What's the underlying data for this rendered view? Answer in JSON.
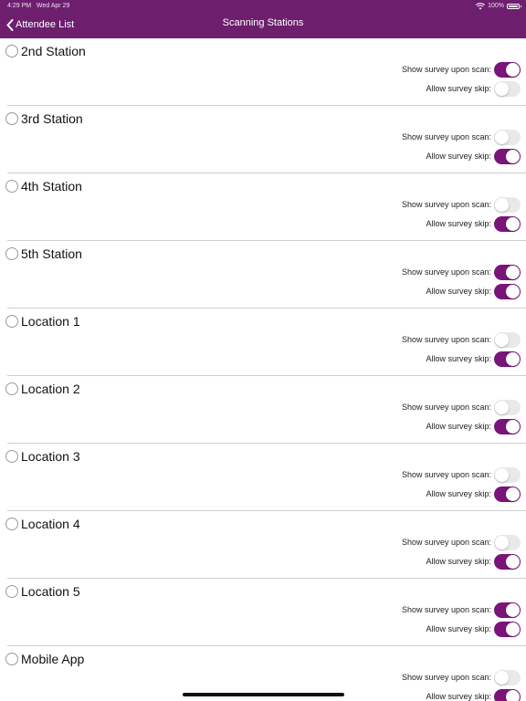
{
  "status_bar": {
    "time": "4:29 PM",
    "date": "Wed Apr 29",
    "battery": "100%"
  },
  "nav": {
    "back_label": "Attendee List",
    "title": "Scanning Stations"
  },
  "settings_labels": {
    "show_survey": "Show survey upon scan:",
    "allow_skip": "Allow survey skip:"
  },
  "colors": {
    "accent": "#7a1479",
    "nav_background": "#6d1f6e",
    "toggle_off": "#e9e9eb"
  },
  "stations": [
    {
      "name": "2nd Station",
      "show_survey": true,
      "allow_skip": false
    },
    {
      "name": "3rd Station",
      "show_survey": false,
      "allow_skip": true
    },
    {
      "name": "4th Station",
      "show_survey": false,
      "allow_skip": true
    },
    {
      "name": "5th Station",
      "show_survey": true,
      "allow_skip": true
    },
    {
      "name": "Location 1",
      "show_survey": false,
      "allow_skip": true
    },
    {
      "name": "Location 2",
      "show_survey": false,
      "allow_skip": true
    },
    {
      "name": "Location 3",
      "show_survey": false,
      "allow_skip": true
    },
    {
      "name": "Location 4",
      "show_survey": false,
      "allow_skip": true
    },
    {
      "name": "Location 5",
      "show_survey": true,
      "allow_skip": true
    },
    {
      "name": "Mobile App",
      "show_survey": false,
      "allow_skip": true
    }
  ]
}
